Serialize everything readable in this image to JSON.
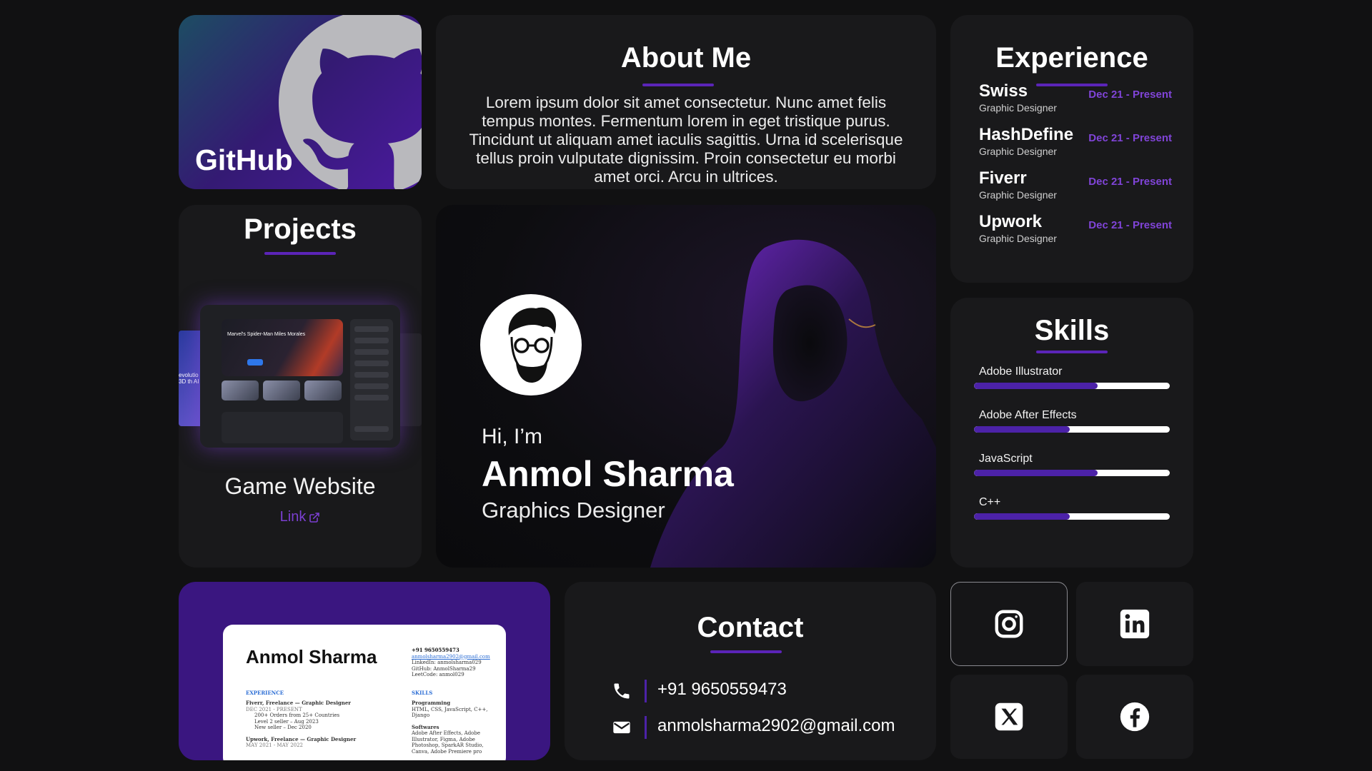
{
  "github": {
    "label": "GitHub"
  },
  "about": {
    "title": "About Me",
    "body": "Lorem ipsum dolor sit amet consectetur. Nunc amet felis tempus montes. Fermentum lorem in eget tristique purus. Tincidunt ut aliquam amet iaculis sagittis. Urna id scelerisque tellus proin vulputate dignissim. Proin consectetur eu morbi amet orci. Arcu in ultrices."
  },
  "experience": {
    "title": "Experience",
    "items": [
      {
        "company": "Swiss",
        "role": "Graphic Designer",
        "date": "Dec 21 - Present"
      },
      {
        "company": "HashDefine",
        "role": "Graphic Designer",
        "date": "Dec 21 - Present"
      },
      {
        "company": "Fiverr",
        "role": "Graphic Designer",
        "date": "Dec 21 - Present"
      },
      {
        "company": "Upwork",
        "role": "Graphic Designer",
        "date": "Dec 21 - Present"
      }
    ]
  },
  "projects": {
    "title": "Projects",
    "project_name": "Game Website",
    "link_label": "Link",
    "preview": {
      "hero_title": "Marvel's Spider-Man Miles Morales",
      "side_text": "evolutio our 3D th AI"
    }
  },
  "hero": {
    "greeting": "Hi, I’m",
    "name": "Anmol Sharma",
    "role": "Graphics Designer"
  },
  "skills": {
    "title": "Skills",
    "items": [
      {
        "label": "Adobe Illustrator",
        "level": 0.63
      },
      {
        "label": "Adobe After Effects",
        "level": 0.49
      },
      {
        "label": "JavaScript",
        "level": 0.63
      },
      {
        "label": "C++",
        "level": 0.49
      }
    ]
  },
  "resume": {
    "name": "Anmol Sharma",
    "contact_lines": [
      "+91 9650559473",
      "anmolsharma2902@gmail.com",
      "LinkedIn: anmolsharma029",
      "GitHub: AnmolSharma29",
      "LeetCode: anmol029"
    ],
    "experience_label": "EXPERIENCE",
    "skills_label": "SKILLS",
    "job1": "Fiverr, Freelance — Graphic Designer",
    "job1_date": "DEC 2021 - PRESENT",
    "job1_bullets": [
      "200+ Orders from 25+ Countries",
      "Level 2 seller – Aug 2023",
      "New seller – Dec 2020"
    ],
    "job2": "Upwork, Freelance — Graphic Designer",
    "job2_date": "MAY 2021 - MAY 2022",
    "prog_label": "Programming",
    "prog_text": "HTML, CSS, JavaScript, C++, Django",
    "soft_label": "Softwares",
    "soft_text": "Adobe After Effects, Adobe Illustrator, Figma, Adobe Photoshop, SparkAR Studio, Canva, Adobe Premiere pro"
  },
  "contact": {
    "title": "Contact",
    "phone": "+91 9650559473",
    "email": "anmolsharma2902@gmail.com"
  },
  "socials": [
    {
      "icon": "instagram-icon"
    },
    {
      "icon": "linkedin-icon"
    },
    {
      "icon": "x-twitter-icon"
    },
    {
      "icon": "facebook-icon"
    }
  ],
  "colors": {
    "accent": "#5b24b8",
    "accent_text": "#8044d8",
    "card": "#19191b",
    "background": "#111112"
  }
}
